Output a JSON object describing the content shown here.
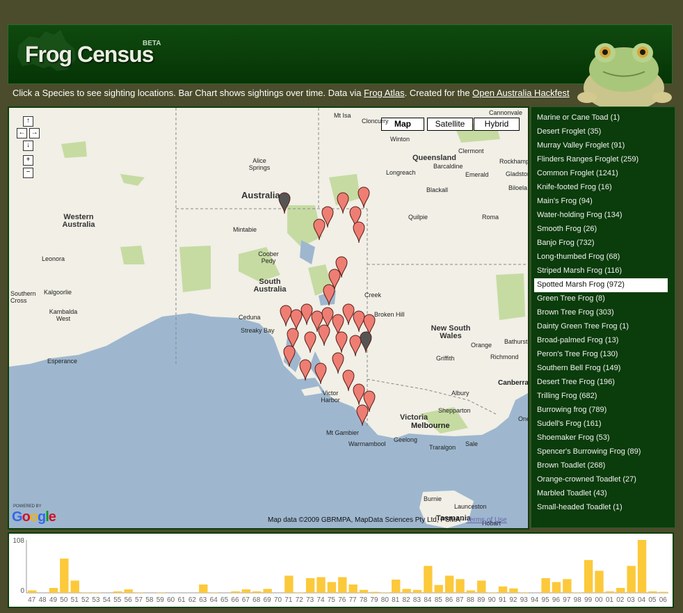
{
  "header": {
    "logo": "Frog Census",
    "beta": "BETA",
    "tagline_prefix": "Click a Species to see sighting locations. Bar Chart shows sightings over time. Data via ",
    "frog_atlas_link": "Frog Atlas",
    "tagline_mid": ". Created for the ",
    "hackfest_link": "Open Australia Hackfest"
  },
  "map": {
    "type_buttons": [
      "Map",
      "Satellite",
      "Hybrid"
    ],
    "selected_type": "Map",
    "nav": {
      "up": "↑",
      "left": "←",
      "right": "→",
      "down": "↓",
      "zoom_in": "+",
      "zoom_out": "−"
    },
    "regions": {
      "australia": "Australia",
      "western_australia": "Western Australia",
      "south_australia": "South Australia",
      "queensland": "Queensland",
      "nsw": "New South Wales",
      "victoria": "Victoria",
      "tasmania": "Tasmania"
    },
    "places": {
      "mt_isa": "Mt Isa",
      "cloncurry": "Cloncurry",
      "cannonvale": "Cannonvale",
      "winton": "Winton",
      "clermont": "Clermont",
      "rockhampton": "Rockhampton",
      "gladstone": "Gladstone",
      "barcaldine": "Barcaldine",
      "longreach": "Longreach",
      "emerald": "Emerald",
      "blackall": "Blackall",
      "biloela": "Biloela",
      "alice_springs": "Alice Springs",
      "roma": "Roma",
      "quilpie": "Quilpie",
      "mintabie": "Mintabie",
      "coober_pedy": "Coober Pedy",
      "leonora": "Leonora",
      "kalgoorlie": "Kalgoorlie",
      "southern_cross": "Southern Cross",
      "kambalda_west": "Kambalda West",
      "esperance": "Esperance",
      "ceduna": "Ceduna",
      "streaky_bay": "Streaky Bay",
      "broken_hill": "Broken Hill",
      "orange": "Orange",
      "bathurst": "Bathurst",
      "griffith": "Griffith",
      "richmond": "Richmond",
      "canberra": "Canberra",
      "albury": "Albury",
      "shepparton": "Shepparton",
      "melbourne": "Melbourne",
      "geelong": "Geelong",
      "traralgon": "Traralgon",
      "sale": "Sale",
      "warrnambool": "Warrnambool",
      "mt_gambier": "Mt Gambier",
      "victor_harbor": "Victor Harbor",
      "burnie": "Burnie",
      "launceston": "Launceston",
      "hobart": "Hobart",
      "creek": "Creek",
      "oneh": "One..."
    },
    "powered_by": "POWERED BY",
    "google": "Google",
    "copyright": "Map data ©2009 GBRMPA, MapData Sciences Pty Ltd, PSMA - ",
    "terms_link": "Terms of Use"
  },
  "species": [
    {
      "name": "Marine or Cane Toad (1)",
      "selected": false
    },
    {
      "name": "Desert Froglet (35)",
      "selected": false
    },
    {
      "name": "Murray Valley Froglet (91)",
      "selected": false
    },
    {
      "name": "Flinders Ranges Froglet (259)",
      "selected": false
    },
    {
      "name": "Common Froglet (1241)",
      "selected": false
    },
    {
      "name": "Knife-footed Frog (16)",
      "selected": false
    },
    {
      "name": "Main's Frog (94)",
      "selected": false
    },
    {
      "name": "Water-holding Frog (134)",
      "selected": false
    },
    {
      "name": "Smooth Frog (26)",
      "selected": false
    },
    {
      "name": "Banjo Frog (732)",
      "selected": false
    },
    {
      "name": "Long-thumbed Frog (68)",
      "selected": false
    },
    {
      "name": "Striped Marsh Frog (116)",
      "selected": false
    },
    {
      "name": "Spotted Marsh Frog (972)",
      "selected": true
    },
    {
      "name": "Green Tree Frog (8)",
      "selected": false
    },
    {
      "name": "Brown Tree Frog (303)",
      "selected": false
    },
    {
      "name": "Dainty Green Tree Frog (1)",
      "selected": false
    },
    {
      "name": "Broad-palmed Frog (13)",
      "selected": false
    },
    {
      "name": "Peron's Tree Frog (130)",
      "selected": false
    },
    {
      "name": "Southern Bell Frog (149)",
      "selected": false
    },
    {
      "name": "Desert Tree Frog (196)",
      "selected": false
    },
    {
      "name": "Trilling Frog (682)",
      "selected": false
    },
    {
      "name": "Burrowing frog (789)",
      "selected": false
    },
    {
      "name": "Sudell's Frog (161)",
      "selected": false
    },
    {
      "name": "Shoemaker Frog (53)",
      "selected": false
    },
    {
      "name": "Spencer's Burrowing Frog (89)",
      "selected": false
    },
    {
      "name": "Brown Toadlet (268)",
      "selected": false
    },
    {
      "name": "Orange-crowned Toadlet (27)",
      "selected": false
    },
    {
      "name": "Marbled Toadlet (43)",
      "selected": false
    },
    {
      "name": "Small-headed Toadlet (1)",
      "selected": false
    }
  ],
  "colors": {
    "bar": "#fcc93b",
    "marker": "#ee7e73",
    "header_green": "#0a420a",
    "page_bg": "#4a4c2b"
  },
  "chart_data": {
    "type": "bar",
    "categories": [
      "47",
      "48",
      "49",
      "50",
      "51",
      "52",
      "53",
      "54",
      "55",
      "56",
      "57",
      "58",
      "59",
      "60",
      "61",
      "62",
      "63",
      "64",
      "65",
      "66",
      "67",
      "68",
      "69",
      "70",
      "71",
      "72",
      "73",
      "74",
      "75",
      "76",
      "77",
      "78",
      "79",
      "80",
      "81",
      "82",
      "83",
      "84",
      "85",
      "86",
      "87",
      "88",
      "89",
      "90",
      "91",
      "92",
      "93",
      "94",
      "95",
      "96",
      "97",
      "98",
      "99",
      "00",
      "01",
      "02",
      "03",
      "04",
      "05",
      "06"
    ],
    "values": [
      5,
      0,
      10,
      70,
      25,
      1,
      1,
      0,
      3,
      7,
      1,
      0,
      1,
      0,
      0,
      0,
      17,
      1,
      0,
      3,
      7,
      3,
      8,
      0,
      35,
      1,
      30,
      32,
      22,
      32,
      17,
      6,
      2,
      1,
      27,
      8,
      6,
      55,
      16,
      35,
      28,
      5,
      25,
      1,
      13,
      9,
      1,
      0,
      30,
      22,
      28,
      1,
      67,
      45,
      3,
      10,
      55,
      108,
      3,
      2
    ],
    "ylim": [
      0,
      108
    ],
    "ytick_labels": [
      "108",
      "0"
    ],
    "grid": false,
    "legend": "none"
  }
}
